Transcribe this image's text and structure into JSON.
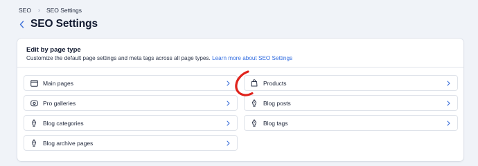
{
  "breadcrumb": {
    "items": [
      "SEO",
      "SEO Settings"
    ]
  },
  "header": {
    "title": "SEO Settings"
  },
  "card": {
    "title": "Edit by page type",
    "description": "Customize the default page settings and meta tags across all page types.",
    "link": "Learn more about SEO Settings"
  },
  "page_types": [
    {
      "label": "Main pages",
      "icon": "browser-window-icon"
    },
    {
      "label": "Products",
      "icon": "shopping-bag-icon"
    },
    {
      "label": "Pro galleries",
      "icon": "gallery-icon"
    },
    {
      "label": "Blog posts",
      "icon": "pen-nib-icon"
    },
    {
      "label": "Blog categories",
      "icon": "pen-nib-icon"
    },
    {
      "label": "Blog tags",
      "icon": "pen-nib-icon"
    },
    {
      "label": "Blog archive pages",
      "icon": "pen-nib-icon"
    }
  ],
  "colors": {
    "accent": "#3b6fd8",
    "link": "#2f6be0",
    "background": "#f0f3f8",
    "annotation": "#e0231c"
  }
}
